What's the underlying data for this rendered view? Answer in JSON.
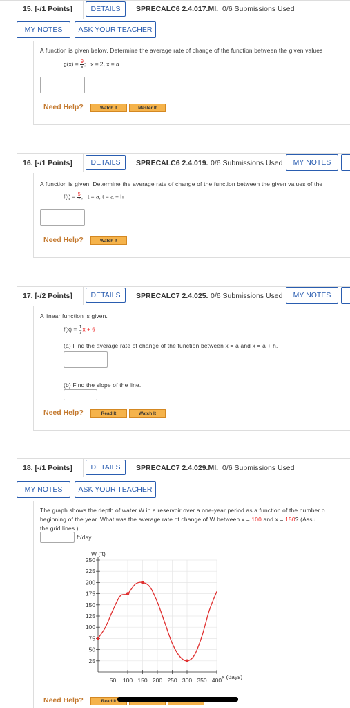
{
  "q15": {
    "number": "15.",
    "points": "[-/1 Points]",
    "details": "DETAILS",
    "code": "SPRECALC6 2.4.017.MI.",
    "submissions": "0/6 Submissions Used",
    "my_notes": "MY NOTES",
    "ask_teacher": "ASK YOUR TEACHER",
    "prompt": "A function is given below. Determine the average rate of change of the function between the given values",
    "func_lhs": "g(x) =",
    "func_num": "9",
    "func_den": "x",
    "func_tail": ";",
    "values": "x = 2, x = a",
    "need_help": "Need Help?",
    "watch": "Watch It",
    "master": "Master It"
  },
  "q16": {
    "number": "16.",
    "points": "[-/1 Points]",
    "details": "DETAILS",
    "code": "SPRECALC6 2.4.019.",
    "submissions": "0/6 Submissions Used",
    "my_notes": "MY NOTES",
    "prompt": "A function is given. Determine the average rate of change of the function between the given values of the",
    "func_lhs": "f(t) =",
    "func_num": "5",
    "func_den": "t",
    "func_tail": ";",
    "values": "t = a, t = a + h",
    "need_help": "Need Help?",
    "watch": "Watch It"
  },
  "q17": {
    "number": "17.",
    "points": "[-/2 Points]",
    "details": "DETAILS",
    "code": "SPRECALC7 2.4.025.",
    "submissions": "0/6 Submissions Used",
    "my_notes": "MY NOTES",
    "prompt": "A linear function is given.",
    "func_lhs": "f(x) =",
    "func_num": "1",
    "func_den": "7",
    "func_tail": "x + 6",
    "part_a": "(a) Find the average rate of change of the function between  x = a  and  x = a + h.",
    "part_b": "(b) Find the slope of the line.",
    "need_help": "Need Help?",
    "read": "Read It",
    "watch": "Watch It"
  },
  "q18": {
    "number": "18.",
    "points": "[-/1 Points]",
    "details": "DETAILS",
    "code": "SPRECALC7 2.4.029.MI.",
    "submissions": "0/6 Submissions Used",
    "my_notes": "MY NOTES",
    "ask_teacher": "ASK YOUR TEACHER",
    "prompt_line1": "The graph shows the depth of water W in a reservoir over a one-year period as a function of the number o",
    "prompt_line2_a": "beginning of the year. What was the average rate of change of W between  x = ",
    "x1": "100",
    "prompt_line2_b": "  and  x = ",
    "x2": "150",
    "prompt_line2_c": "? (Assu",
    "prompt_line3": "the grid lines.)",
    "unit": "ft/day",
    "need_help": "Need Help?",
    "read": "Read It"
  },
  "chart_data": {
    "type": "line",
    "title": "",
    "ylabel": "W (ft)",
    "xlabel": "x (days)",
    "xlim": [
      0,
      400
    ],
    "ylim": [
      0,
      250
    ],
    "xticks": [
      50,
      100,
      150,
      200,
      250,
      300,
      350,
      400
    ],
    "yticks": [
      25,
      50,
      75,
      100,
      125,
      150,
      175,
      200,
      225,
      250
    ],
    "grid": true,
    "series": [
      {
        "x": [
          0,
          25,
          50,
          75,
          100,
          125,
          150,
          175,
          200,
          225,
          250,
          275,
          300,
          325,
          350,
          375,
          400
        ],
        "y": [
          75,
          100,
          138,
          170,
          175,
          196,
          200,
          190,
          156,
          110,
          64,
          35,
          25,
          38,
          80,
          138,
          180
        ]
      }
    ],
    "highlighted_points": [
      {
        "x": 0,
        "y": 75
      },
      {
        "x": 100,
        "y": 175
      },
      {
        "x": 150,
        "y": 200
      },
      {
        "x": 300,
        "y": 25
      }
    ],
    "line_color": "#e03030"
  }
}
